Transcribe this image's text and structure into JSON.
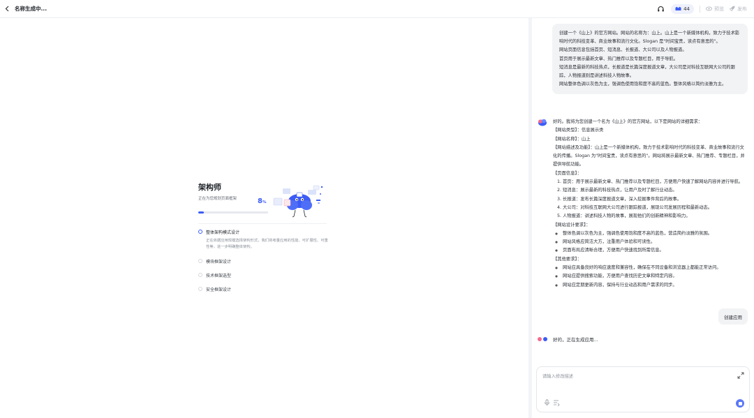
{
  "topbar": {
    "title": "名称生成中...",
    "credits": "44",
    "preview_label": "预览",
    "publish_label": "发布"
  },
  "architect": {
    "title": "架构师",
    "subtitle": "正在为您规划页面框架",
    "percent": "8",
    "percent_unit": "%",
    "progress": 0.08,
    "steps": [
      {
        "label": "整体架构模式设计",
        "desc": "正在依据应用规模选择架构形式，我们将考量应用的性能、可扩展性、可重性等，进一步明确整体架构。",
        "active": true
      },
      {
        "label": "模块框架设计"
      },
      {
        "label": "技术框架选型"
      },
      {
        "label": "安全框架设计"
      }
    ]
  },
  "chat": {
    "user_message": [
      "创建一个《山上》的官方网站。网站的名称为：山上。山上是一个新媒体机构，致力于技术影响时代的科技变革、商业故事和流行文化。Slogan 是\"时间宝贵，读点有意思的\"。",
      "网站页面信息包括首页、短消息、长报道、大公司以及人物报道。",
      "首页用于展示最新文章、热门推荐以及专题栏目，用于导航。",
      "短消息是最新的科技热点，长报道是长篇深度报道文章，大公司是对科技互联网大公司的跟踪，人物报道则是讲述科技人物故事。",
      "网站整体色调以灰色为主，强调色使用饱和度不高的蓝色。整体风格以简约淡雅为主。"
    ],
    "ai_intro": "好的。我将为您创建一个名为《山上》的官方网站，以下是网站的详细需求：",
    "site_type": "【网站类型】：信息展示类",
    "site_name": "【网站名称】：山上",
    "site_desc": "【网站描述及功能】：山上是一个新媒体机构，致力于技术影响时代的科技变革、商业故事和流行文化的传播。Slogan 为\"时间宝贵，读点有意思的\"。网站将展示最新文章、热门推荐、专题栏目，并提供导航功能。",
    "pages_heading": "【页面信息】：",
    "pages": [
      "首页：用于展示最新文章、热门推荐以及专题栏目，方便用户快速了解网站内容并进行导航。",
      "短消息：展示最新的科技热点，让用户及时了解行业动态。",
      "长报道：发布长篇深度报道文章，深入挖掘事件背后的故事。",
      "大公司：对科技互联网大公司进行跟踪报道，展现公司发展历程和最新动态。",
      "人物报道：讲述科技人物的故事，展现他们的创新精神和影响力。"
    ],
    "design_heading": "【网站设计要求】：",
    "design": [
      "整体色调以灰色为主，强调色使用饱和度不高的蓝色，营造简约淡雅的氛围。",
      "网站风格应简洁大方，注重用户体验和可读性。",
      "页面布局应清晰合理，方便用户快速找到所需信息。"
    ],
    "other_heading": "【其他要求】：",
    "other": [
      "网站应具备良好的响应速度和兼容性，确保在不同设备和浏览器上都能正常访问。",
      "网站应提供搜索功能，方便用户查找历史文章和特定内容。",
      "网站应定期更新内容，保持与行业动态和用户需求的同步。"
    ],
    "create_app_label": "创建应用",
    "status_text": "好的，正在生成应用...",
    "input_placeholder": "请输入修改描述"
  },
  "colors": {
    "accent": "#3c5cf6",
    "background": "#f3f4f7",
    "bubble": "#f2f3f5"
  },
  "icons": [
    "back-icon",
    "headset-icon",
    "credits-icon",
    "eye-icon",
    "rocket-icon",
    "expand-icon",
    "mic-icon",
    "format-icon",
    "stop-icon"
  ]
}
